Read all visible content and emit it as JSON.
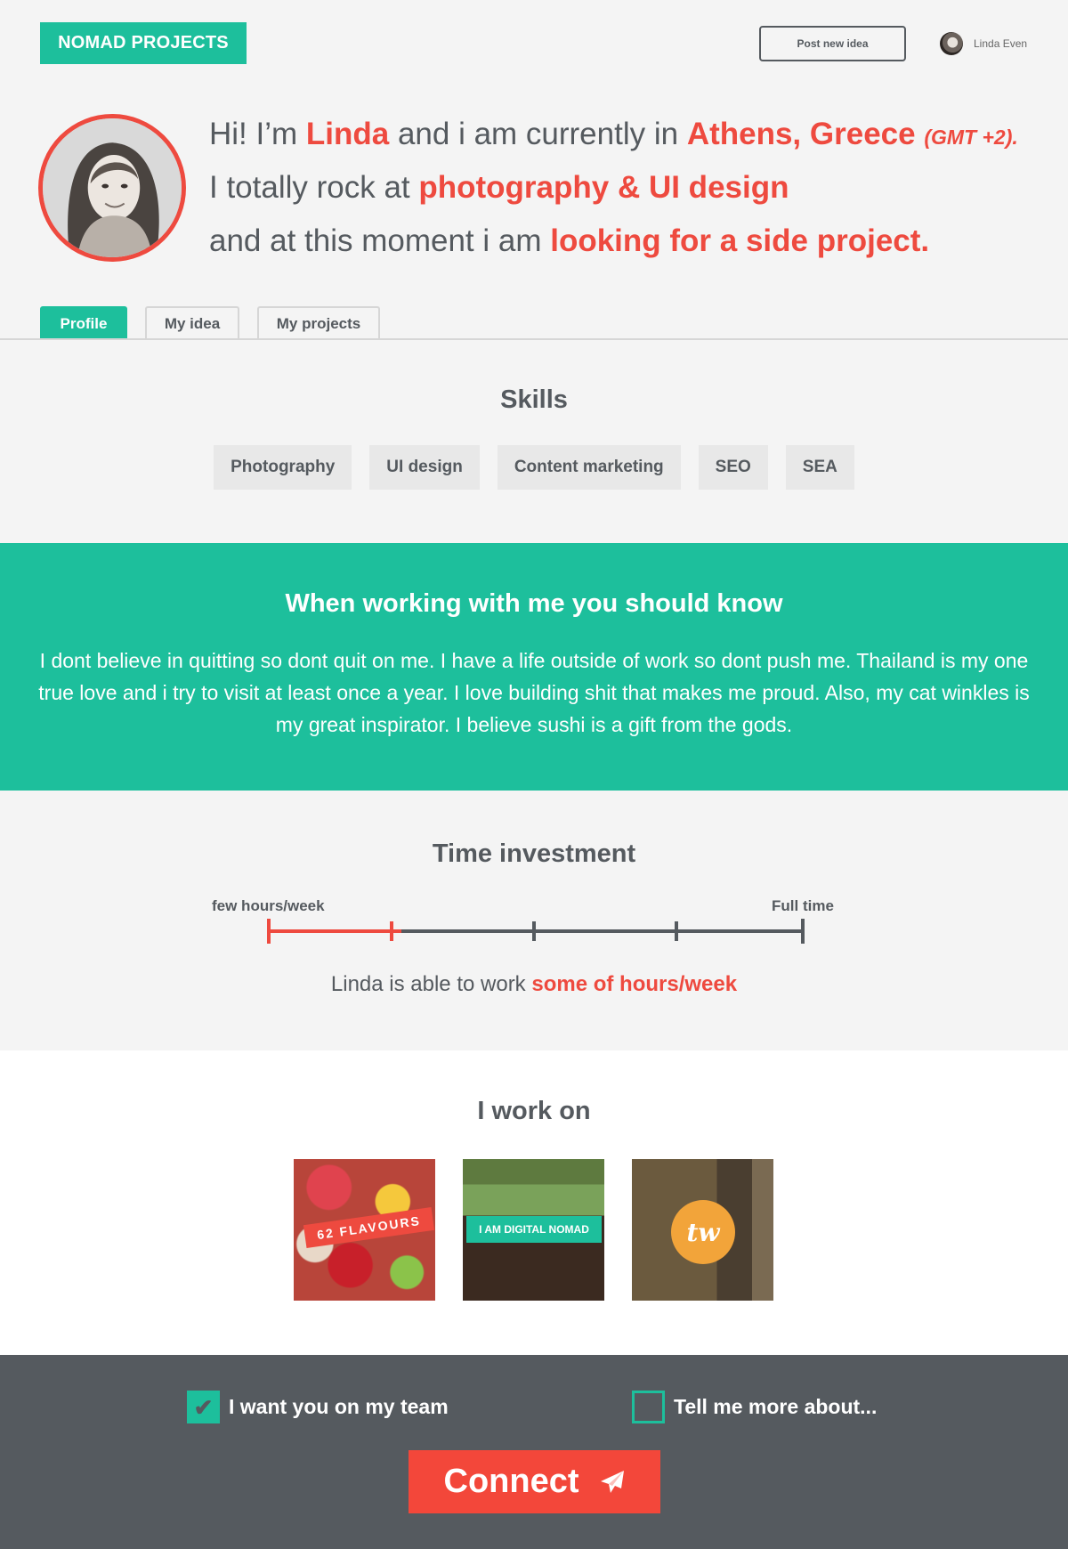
{
  "header": {
    "logo": "NOMAD PROJECTS",
    "post_button": "Post new idea",
    "user_name": "Linda Even"
  },
  "intro": {
    "l1_a": "Hi! I’m ",
    "l1_name": "Linda",
    "l1_b": " and i am currently in ",
    "l1_place": "Athens, Greece",
    "l1_gmt": "(GMT +2).",
    "l2_a": "I totally rock at ",
    "l2_skill": "photography & UI design",
    "l3_a": "and at this moment i am ",
    "l3_status": "looking for a side project."
  },
  "tabs": [
    "Profile",
    "My idea",
    "My projects"
  ],
  "skills": {
    "title": "Skills",
    "items": [
      "Photography",
      "UI design",
      "Content marketing",
      "SEO",
      "SEA"
    ]
  },
  "know": {
    "title": "When working with me you should know",
    "text": "I dont believe in quitting so dont quit on me. I have a life outside of work so dont push me. Thailand is my one true love and i try to visit at least once a year. I love building shit that makes me proud. Also, my cat winkles is my great inspirator. I believe sushi is a gift from the gods."
  },
  "time": {
    "title": "Time investment",
    "min_label": "few hours/week",
    "max_label": "Full time",
    "level": 0.25,
    "steps": 5,
    "sentence_a": "Linda is able to work ",
    "sentence_value": "some of hours/week"
  },
  "work": {
    "title": "I work on",
    "projects": [
      {
        "label": "62 FLAVOURS"
      },
      {
        "label": "I AM DIGITAL NOMAD"
      },
      {
        "label": "tw"
      }
    ]
  },
  "footer": {
    "check1": "I want you on my team",
    "check2": "Tell me more about...",
    "connect": "Connect"
  },
  "colors": {
    "accent_green": "#1dbf9c",
    "accent_red": "#ee4a3f",
    "dark": "#555a5f"
  }
}
